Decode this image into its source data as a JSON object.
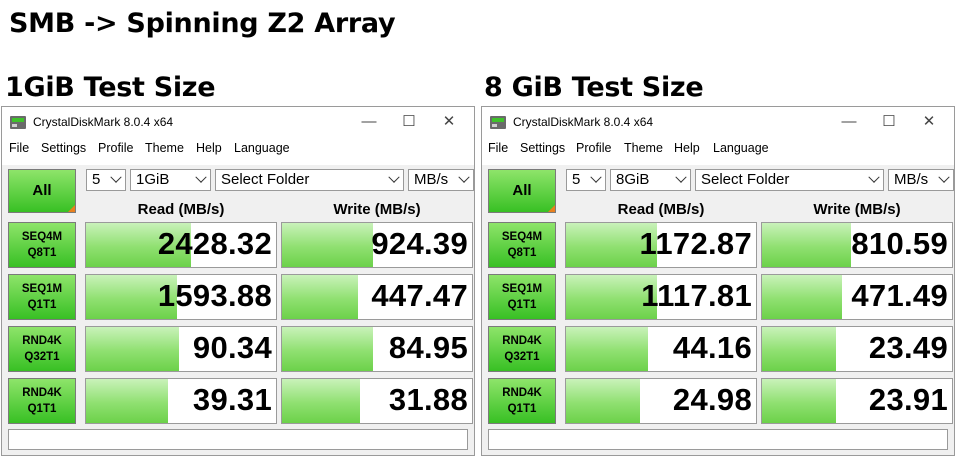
{
  "page_title": "SMB -> Spinning Z2 Array",
  "panels": [
    {
      "heading": "1GiB Test Size",
      "window_title": "CrystalDiskMark 8.0.4 x64",
      "menu": [
        "File",
        "Settings",
        "Profile",
        "Theme",
        "Help",
        "Language"
      ],
      "all_label": "All",
      "count": "5",
      "size": "1GiB",
      "folder": "Select Folder",
      "unit": "MB/s",
      "read_header": "Read (MB/s)",
      "write_header": "Write (MB/s)",
      "rows": [
        {
          "line1": "SEQ4M",
          "line2": "Q8T1",
          "read": "2428.32",
          "read_fill": 0.55,
          "write": "924.39",
          "write_fill": 0.48
        },
        {
          "line1": "SEQ1M",
          "line2": "Q1T1",
          "read": "1593.88",
          "read_fill": 0.48,
          "write": "447.47",
          "write_fill": 0.4
        },
        {
          "line1": "RND4K",
          "line2": "Q32T1",
          "read": "90.34",
          "read_fill": 0.49,
          "write": "84.95",
          "write_fill": 0.48
        },
        {
          "line1": "RND4K",
          "line2": "Q1T1",
          "read": "39.31",
          "read_fill": 0.43,
          "write": "31.88",
          "write_fill": 0.41
        }
      ]
    },
    {
      "heading": "8 GiB Test Size",
      "window_title": "CrystalDiskMark 8.0.4 x64",
      "menu": [
        "File",
        "Settings",
        "Profile",
        "Theme",
        "Help",
        "Language"
      ],
      "all_label": "All",
      "count": "5",
      "size": "8GiB",
      "folder": "Select Folder",
      "unit": "MB/s",
      "read_header": "Read (MB/s)",
      "write_header": "Write (MB/s)",
      "rows": [
        {
          "line1": "SEQ4M",
          "line2": "Q8T1",
          "read": "1172.87",
          "read_fill": 0.48,
          "write": "810.59",
          "write_fill": 0.47
        },
        {
          "line1": "SEQ1M",
          "line2": "Q1T1",
          "read": "1117.81",
          "read_fill": 0.48,
          "write": "471.49",
          "write_fill": 0.42
        },
        {
          "line1": "RND4K",
          "line2": "Q32T1",
          "read": "44.16",
          "read_fill": 0.43,
          "write": "23.49",
          "write_fill": 0.39
        },
        {
          "line1": "RND4K",
          "line2": "Q1T1",
          "read": "24.98",
          "read_fill": 0.39,
          "write": "23.91",
          "write_fill": 0.39
        }
      ]
    }
  ]
}
